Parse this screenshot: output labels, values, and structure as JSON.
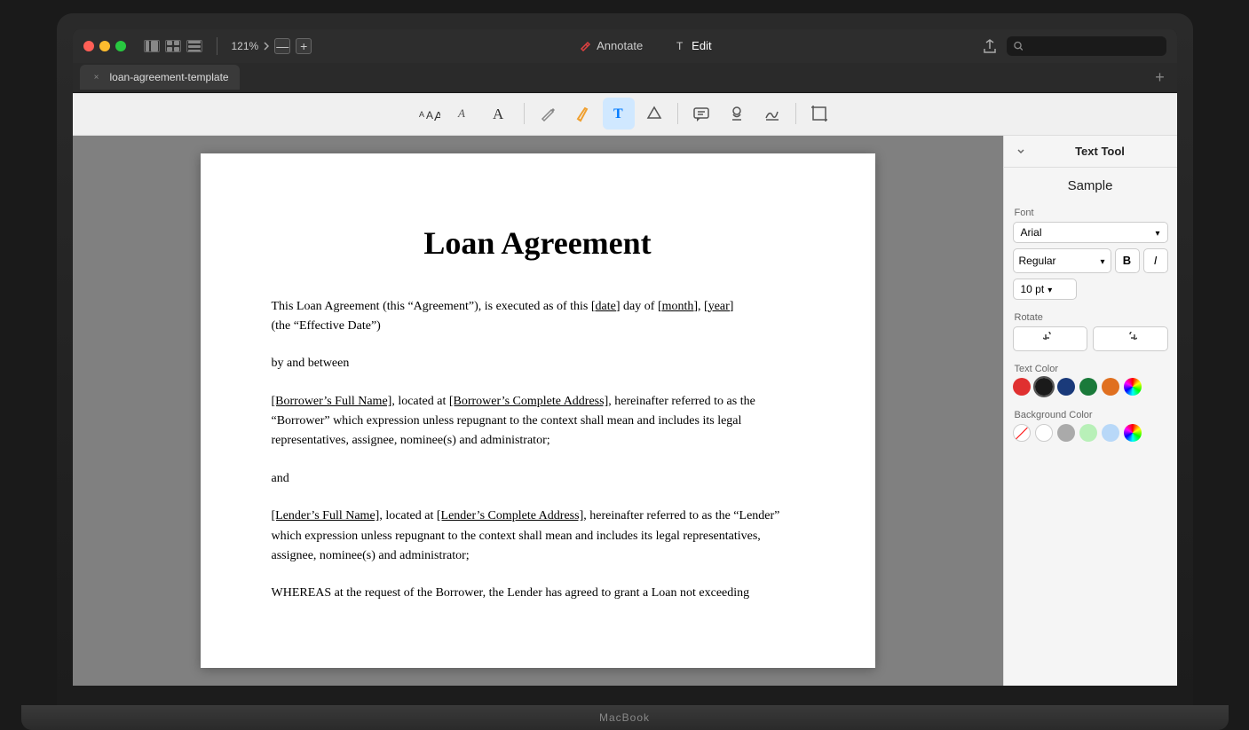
{
  "laptop": {
    "label": "MacBook"
  },
  "titlebar": {
    "zoom_level": "121%",
    "zoom_decrease": "—",
    "zoom_increase": "+",
    "annotate_label": "Annotate",
    "edit_label": "Edit"
  },
  "tab": {
    "name": "loan-agreement-template",
    "close_label": "×",
    "add_label": "+"
  },
  "toolbar": {
    "tools": [
      {
        "id": "text-resize",
        "symbol": "⬛",
        "label": "Text Resize"
      },
      {
        "id": "text-small",
        "symbol": "A",
        "label": "Small Text"
      },
      {
        "id": "text-large",
        "symbol": "A",
        "label": "Large Text"
      },
      {
        "id": "pencil",
        "symbol": "✏",
        "label": "Pencil"
      },
      {
        "id": "highlight",
        "symbol": "🖊",
        "label": "Highlight"
      },
      {
        "id": "text-insert",
        "symbol": "T",
        "label": "Text Insert",
        "active": true
      },
      {
        "id": "shapes",
        "symbol": "⬡",
        "label": "Shapes"
      },
      {
        "id": "comment",
        "symbol": "💬",
        "label": "Comment"
      },
      {
        "id": "stamp",
        "symbol": "👤",
        "label": "Stamp"
      },
      {
        "id": "signature",
        "symbol": "🖋",
        "label": "Signature"
      },
      {
        "id": "crop",
        "symbol": "⛶",
        "label": "Crop"
      }
    ]
  },
  "pdf": {
    "title": "Loan Agreement",
    "paragraphs": [
      {
        "id": "p1",
        "text": "This Loan Agreement (this “Agreement”), is executed as of this [date] day of [month], [year] (the “Effective Date”)",
        "underlined": [
          "[date]",
          "[month]",
          "[year]"
        ]
      },
      {
        "id": "p2",
        "text": "by and between"
      },
      {
        "id": "p3",
        "text": "[Borrower’s Full Name], located at [Borrower’s Complete Address], hereinafter referred to as the “Borrower” which expression unless repugnant to the context shall mean and includes its legal representatives, assignee, nominee(s) and administrator;",
        "underlined": [
          "[Borrower’s Full Name]",
          "[Borrower’s Complete Address]"
        ]
      },
      {
        "id": "p4",
        "text": "and"
      },
      {
        "id": "p5",
        "text": "[Lender’s Full Name], located at [Lender’s Complete Address], hereinafter referred to as the “Lender” which expression unless repugnant to the context shall mean and includes its legal representatives, assignee, nominee(s) and administrator;",
        "underlined": [
          "[Lender’s Full Name]",
          "[Lender’s Complete Address]"
        ]
      },
      {
        "id": "p6",
        "text": "WHEREAS at the request of the Borrower, the Lender has agreed to grant a Loan not exceeding"
      }
    ]
  },
  "right_panel": {
    "title": "Text Tool",
    "sample_text": "Sample",
    "font_label": "Font",
    "font_value": "Arial",
    "font_style_value": "Regular",
    "bold_label": "B",
    "italic_label": "I",
    "font_size_value": "10 pt",
    "rotate_label": "Rotate",
    "text_color_label": "Text Color",
    "text_colors": [
      {
        "id": "red",
        "color": "#e03030",
        "selected": false
      },
      {
        "id": "black",
        "color": "#1a1a1a",
        "selected": true
      },
      {
        "id": "dark-blue",
        "color": "#1a3a7a",
        "selected": false
      },
      {
        "id": "green",
        "color": "#1a7a3a",
        "selected": false
      },
      {
        "id": "orange",
        "color": "#e07020",
        "selected": false
      },
      {
        "id": "multicolor",
        "color": "conic-gradient(red, yellow, lime, cyan, blue, magenta, red)",
        "selected": false,
        "type": "conic"
      }
    ],
    "bg_color_label": "Background Color",
    "bg_colors": [
      {
        "id": "no-fill",
        "color": "none",
        "selected": true,
        "type": "no-fill"
      },
      {
        "id": "white",
        "color": "#ffffff"
      },
      {
        "id": "gray",
        "color": "#aaaaaa"
      },
      {
        "id": "light-green",
        "color": "#b8f0b8"
      },
      {
        "id": "light-blue",
        "color": "#b8d8f8"
      },
      {
        "id": "multicolor",
        "color": "conic-gradient(red, yellow, lime, cyan, blue, magenta, red)",
        "type": "conic"
      }
    ]
  }
}
